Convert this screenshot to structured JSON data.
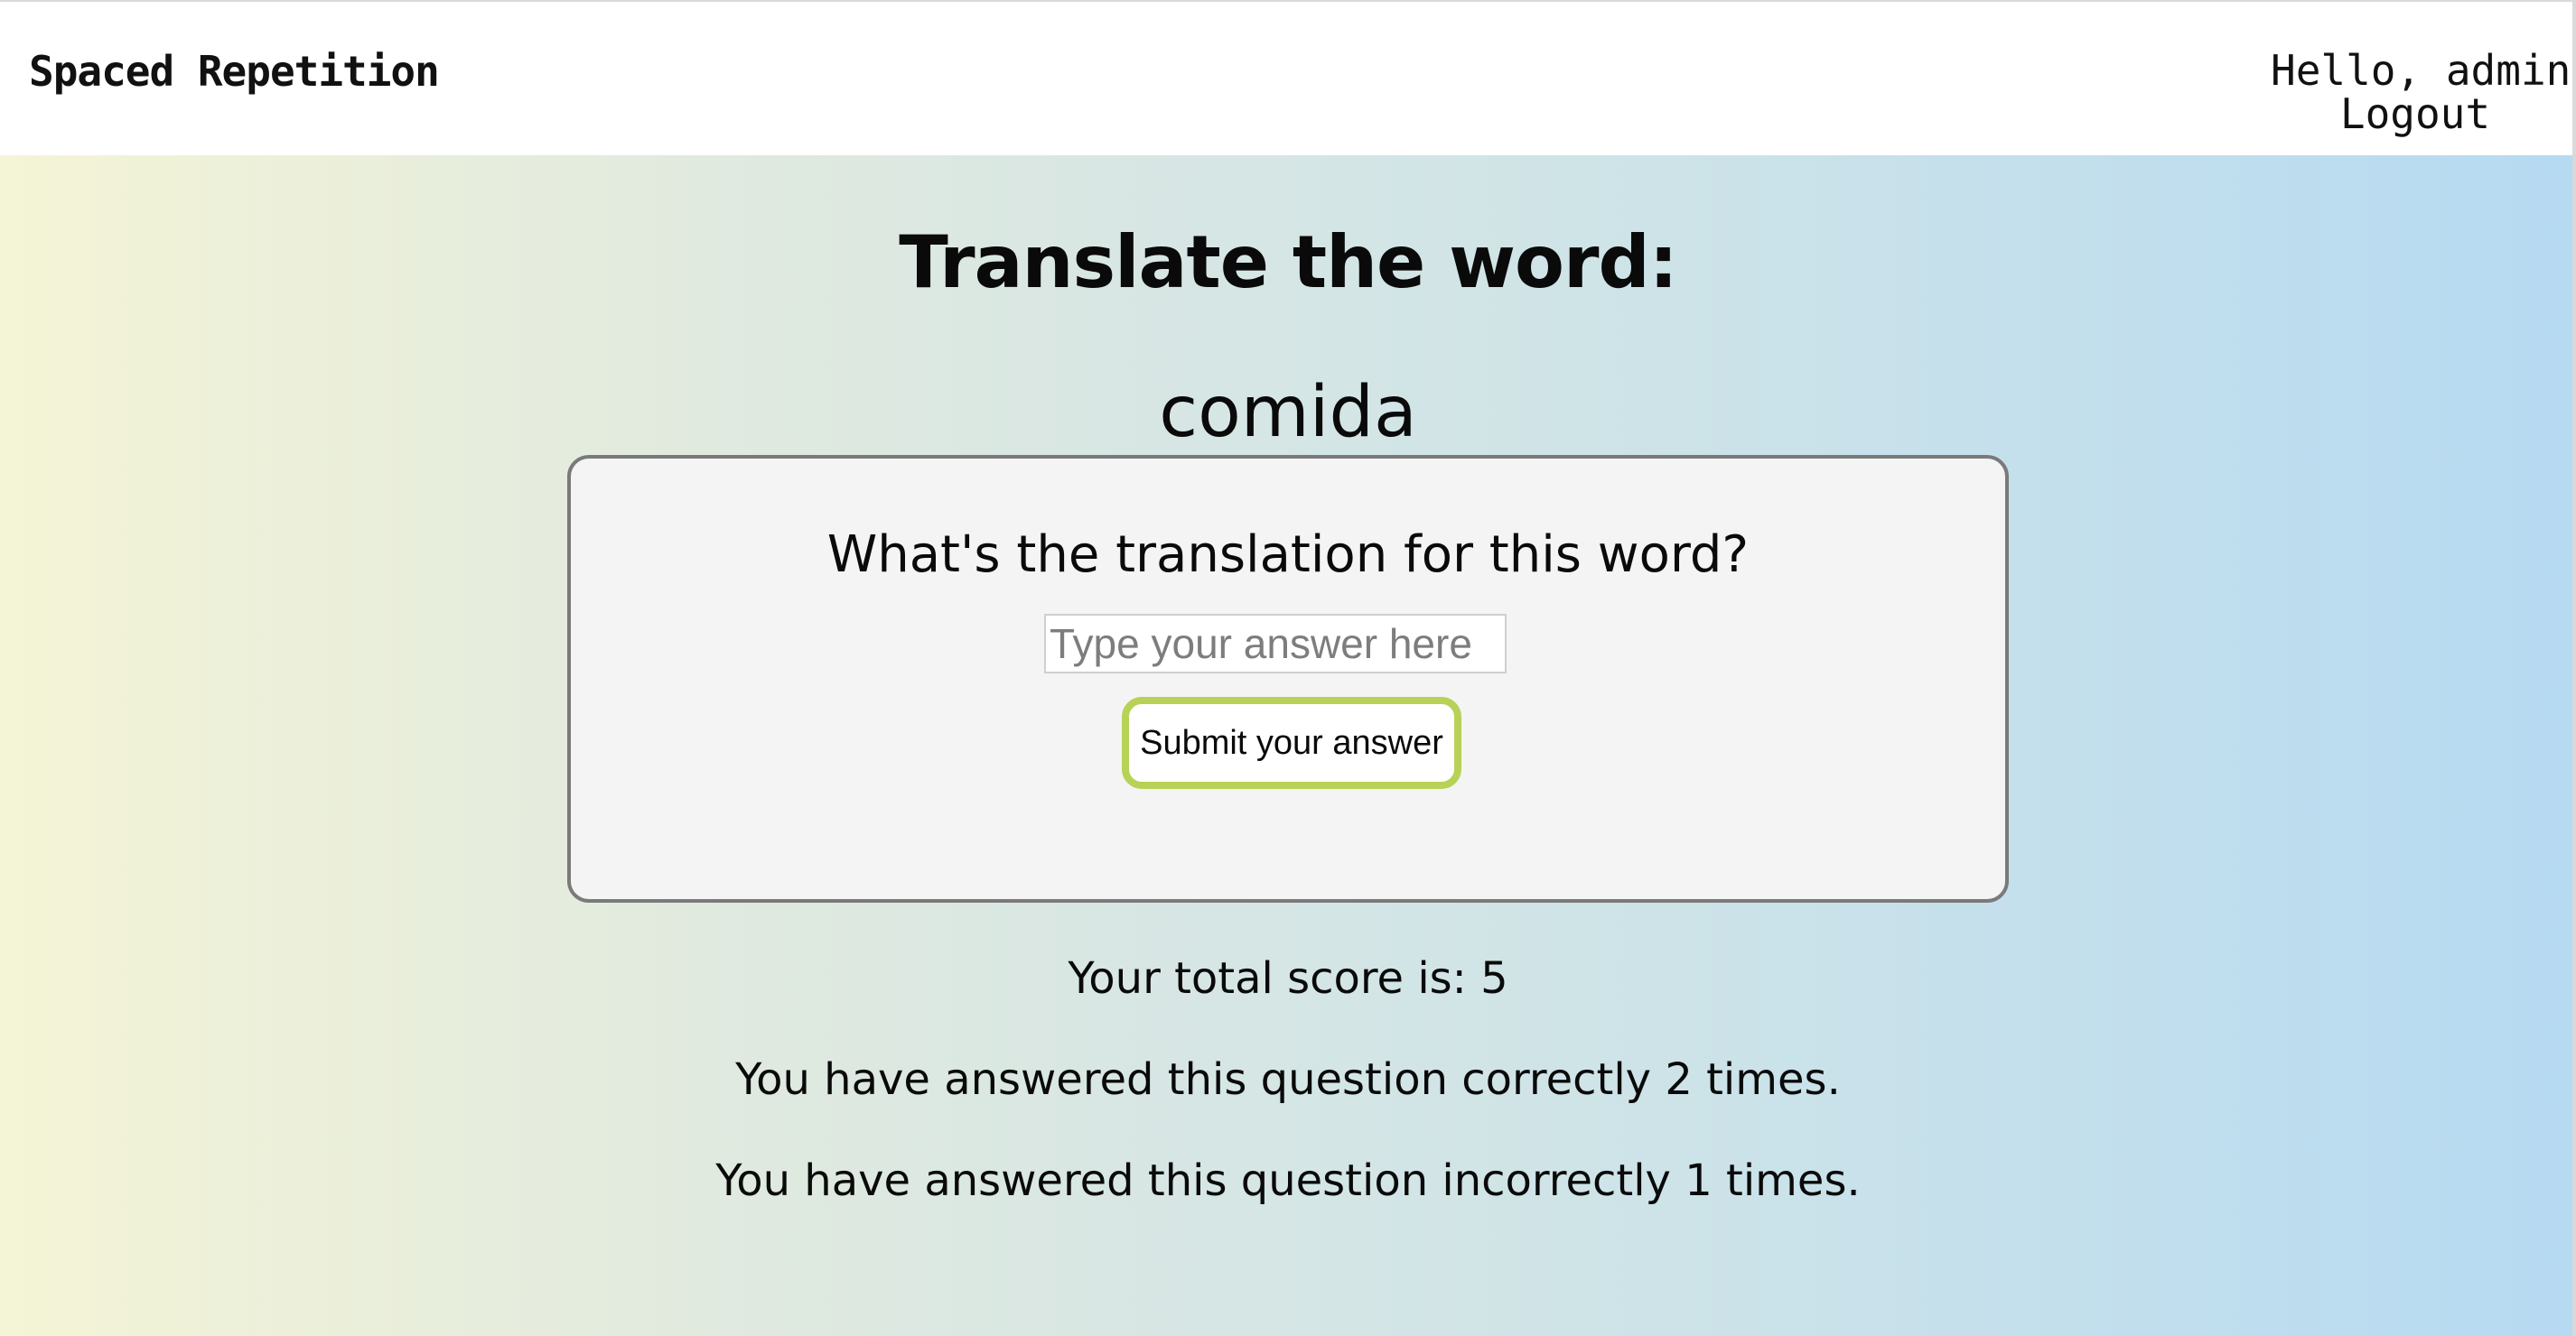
{
  "header": {
    "brand": "Spaced Repetition",
    "greeting": "Hello, admin",
    "logout_label": "Logout"
  },
  "main": {
    "title": "Translate the word:",
    "word": "comida"
  },
  "card": {
    "prompt": "What's the translation for this word?",
    "input_placeholder": "Type your answer here",
    "input_value": "",
    "submit_label": "Submit your answer"
  },
  "stats": {
    "score": "Your total score is: 5",
    "correct": "You have answered this question correctly 2 times.",
    "incorrect": "You have answered this question incorrectly 1 times."
  },
  "colors": {
    "accent": "#b7d257",
    "gradient_start": "#f4f4d6",
    "gradient_end": "#b6daf2"
  }
}
